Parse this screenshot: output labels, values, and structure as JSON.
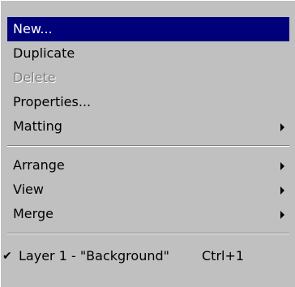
{
  "menu": {
    "items": [
      {
        "label": "New...",
        "state": "highlighted"
      },
      {
        "label": "Duplicate"
      },
      {
        "label": "Delete",
        "state": "disabled"
      },
      {
        "label": "Properties..."
      },
      {
        "label": "Matting",
        "submenu": true
      },
      {
        "label": "Arrange",
        "submenu": true
      },
      {
        "label": "View",
        "submenu": true
      },
      {
        "label": "Merge",
        "submenu": true
      },
      {
        "label": "Layer 1 - \"Background\"",
        "shortcut": "Ctrl+1",
        "checked": true
      }
    ]
  },
  "colors": {
    "menu_bg": "#c0c0c0",
    "highlight_bg": "#00007b",
    "highlight_text": "#ffffff",
    "disabled_text": "#808080"
  },
  "icons": {
    "check": "checkmark-icon",
    "submenu": "submenu-arrow-icon"
  }
}
